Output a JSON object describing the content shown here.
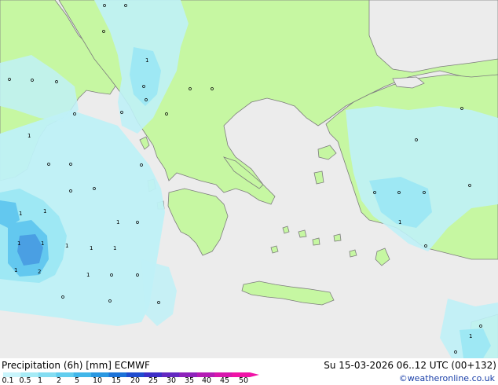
{
  "map": {
    "colors": {
      "sea": "#ececec",
      "land": "#c6f7a2",
      "coast": "#7d7d7d",
      "precip_light": "#bff1f7",
      "precip_mid": "#9ee8f4",
      "precip_heavy": "#63c8ef",
      "precip_max": "#4a9fe3"
    },
    "point_labels": [
      "1",
      "1",
      "1",
      "1",
      "1",
      "1",
      "1",
      "1",
      "1",
      "1",
      "1",
      "1",
      "2",
      "1",
      "1"
    ]
  },
  "footer": {
    "title": "Precipitation (6h) [mm] ECMWF",
    "valid": "Su 15-03-2026 06..12 UTC (00+132)",
    "credit": "©weatheronline.co.uk",
    "legend_ticks": [
      "0.1",
      "0.5",
      "1",
      "2",
      "5",
      "10",
      "15",
      "20",
      "25",
      "30",
      "35",
      "40",
      "45",
      "50"
    ],
    "legend_colors": [
      "#c8f4fb",
      "#a6ebf6",
      "#84ddf2",
      "#62cdee",
      "#41b6e9",
      "#2a98e1",
      "#1b72d8",
      "#1f4ccf",
      "#3d2ec7",
      "#6328c1",
      "#8d22bb",
      "#b41cb4",
      "#d817ad",
      "#f013a7"
    ]
  }
}
